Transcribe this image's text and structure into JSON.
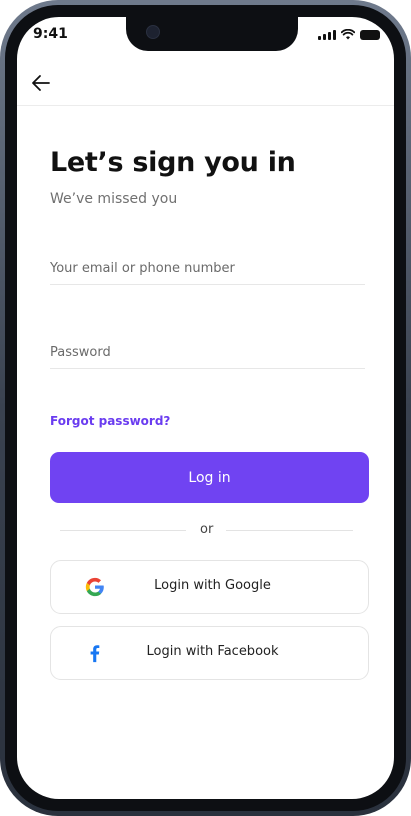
{
  "status_bar": {
    "time": "9:41"
  },
  "header": {
    "back_icon": "arrow-left-icon"
  },
  "signin": {
    "title": "Let’s sign you in",
    "subtitle": "We’ve missed you",
    "email_placeholder": "Your email or phone number",
    "email_value": "",
    "password_placeholder": "Password",
    "password_value": "",
    "forgot_label": "Forgot password?",
    "login_label": "Log in",
    "or_label": "or"
  },
  "social": {
    "google_label": "Login with Google",
    "google_icon": "google-icon",
    "facebook_label": "Login with Facebook",
    "facebook_icon": "facebook-icon"
  },
  "colors": {
    "accent": "#7043f2",
    "link": "#6a3cf0",
    "facebook_blue": "#1877f2"
  }
}
